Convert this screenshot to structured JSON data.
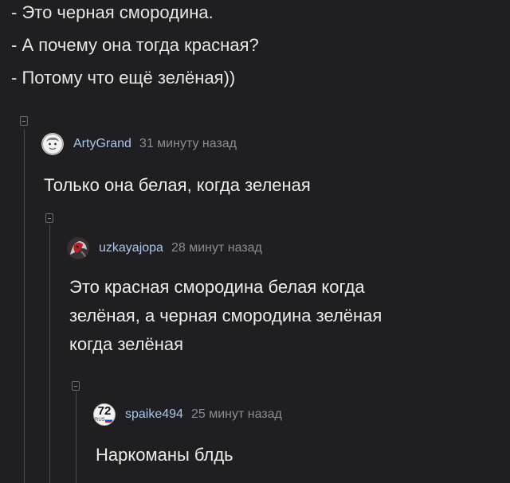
{
  "post": {
    "lines": [
      "- Это черная смородина.",
      "- А почему она тогда красная?",
      "- Потому что ещё зелёная))"
    ]
  },
  "comments": [
    {
      "username": "ArtyGrand",
      "time": "31 минуту назад",
      "text": "Только она белая, когда зеленая"
    },
    {
      "username": "uzkayajopa",
      "time": "28 минут назад",
      "text_lines": [
        "Это красная смородина белая когда",
        "зелёная, а черная смородина зелёная",
        "когда зелёная"
      ]
    },
    {
      "username": "spaike494",
      "time": "25 минут назад",
      "avatar_number": "72",
      "avatar_sub": "RUS",
      "text": "Наркоманы блдь"
    }
  ],
  "colors": {
    "background": "#1f1f22",
    "username": "#a9c7ec",
    "timestamp": "#8c8c90",
    "text": "#ececec",
    "thread_line": "#4a4a4e"
  }
}
